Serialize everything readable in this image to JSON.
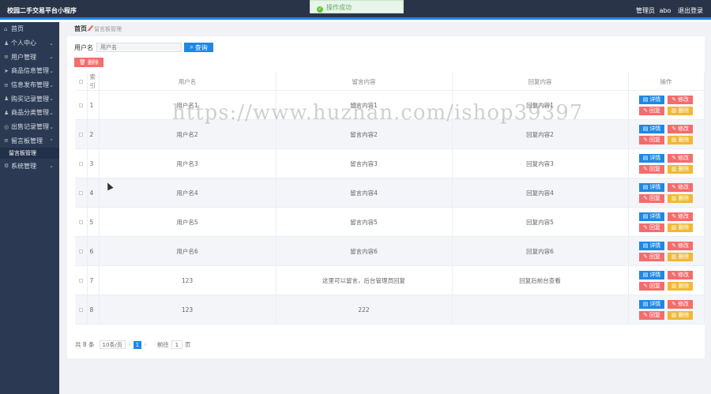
{
  "header": {
    "app_title": "校园二手交易平台小程序",
    "role": "管理员",
    "username": "abo",
    "logout": "退出登录"
  },
  "toast": {
    "message": "操作成功"
  },
  "sidebar": {
    "items": [
      {
        "label": "首页",
        "icon": "home-icon"
      },
      {
        "label": "个人中心",
        "icon": "user-icon"
      },
      {
        "label": "用户管理",
        "icon": "list-icon"
      },
      {
        "label": "商品信息管理",
        "icon": "send-icon"
      },
      {
        "label": "信息发布管理",
        "icon": "list-icon"
      },
      {
        "label": "购买记录管理",
        "icon": "user-icon"
      },
      {
        "label": "商品分类管理",
        "icon": "user-icon"
      },
      {
        "label": "出售记录管理",
        "icon": "circle-icon"
      },
      {
        "label": "留言板管理",
        "icon": "list-icon"
      },
      {
        "label": "系统管理",
        "icon": "gear-icon"
      }
    ],
    "sub_items": [
      {
        "label": "留言板管理"
      }
    ]
  },
  "breadcrumb": {
    "home": "首页",
    "separator": "⁄⁄",
    "current": "留言板管理"
  },
  "search": {
    "label": "用户名",
    "placeholder": "用户名",
    "button": "查询"
  },
  "batch_delete": "删除",
  "table": {
    "columns": [
      "索引",
      "用户名",
      "留言内容",
      "回复内容",
      "操作"
    ],
    "rows": [
      {
        "idx": "1",
        "username": "用户名1",
        "message": "留言内容1",
        "reply": "回复内容1"
      },
      {
        "idx": "2",
        "username": "用户名2",
        "message": "留言内容2",
        "reply": "回复内容2"
      },
      {
        "idx": "3",
        "username": "用户名3",
        "message": "留言内容3",
        "reply": "回复内容3"
      },
      {
        "idx": "4",
        "username": "用户名4",
        "message": "留言内容4",
        "reply": "回复内容4"
      },
      {
        "idx": "5",
        "username": "用户名5",
        "message": "留言内容5",
        "reply": "回复内容5"
      },
      {
        "idx": "6",
        "username": "用户名6",
        "message": "留言内容6",
        "reply": "回复内容6"
      },
      {
        "idx": "7",
        "username": "123",
        "message": "这里可以留言，后台管理员回复",
        "reply": "回复后前台查看"
      },
      {
        "idx": "8",
        "username": "123",
        "message": "222",
        "reply": ""
      }
    ],
    "actions": {
      "detail": "详情",
      "edit": "修改",
      "reply": "回复",
      "delete": "删除"
    }
  },
  "pagination": {
    "total": "共 8 条",
    "page_size": "10条/页",
    "current_page": "1",
    "goto": "前往",
    "goto_value": "1",
    "page_suffix": "页"
  },
  "watermark": "https://www.huzhan.com/ishop39397",
  "colors": {
    "topbar": "#2a3448",
    "sidebar": "#2b3a52",
    "primary": "#1e88e5",
    "danger": "#f56c6c",
    "warning": "#f2b833"
  }
}
